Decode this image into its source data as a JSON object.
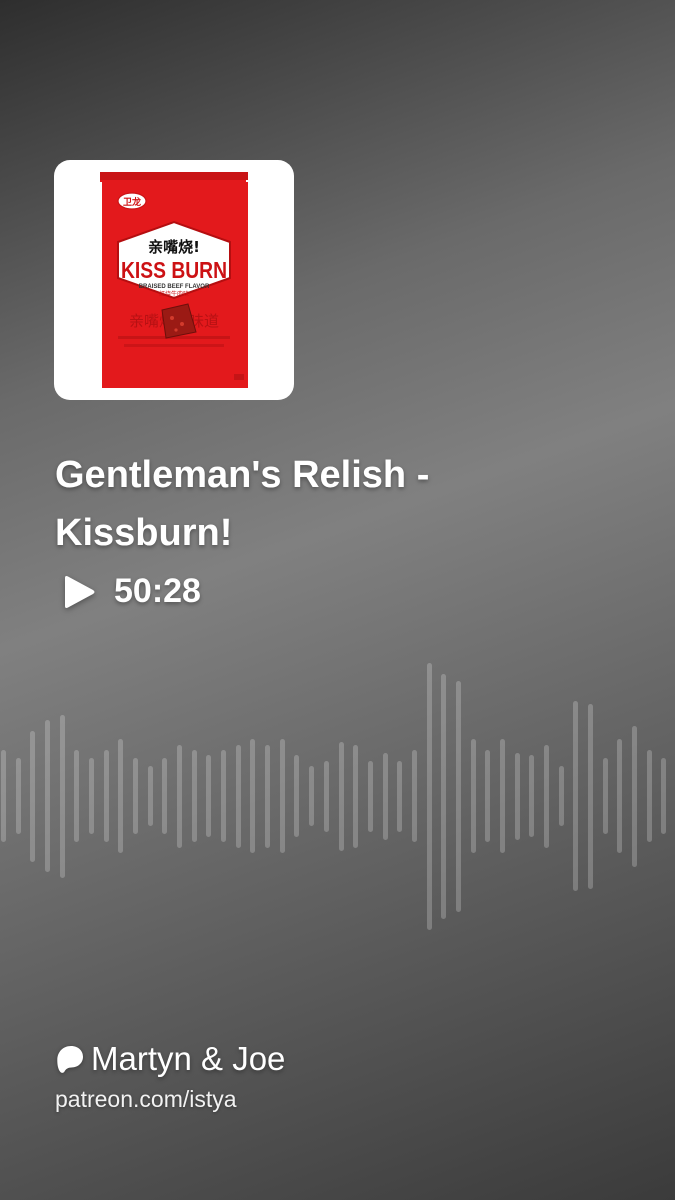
{
  "episode": {
    "title": "Gentleman's Relish - Kissburn!",
    "duration": "50:28",
    "artwork": {
      "subject": "Kiss Burn braised beef flavor snack bag",
      "brand_text": "卫龙",
      "headline_cn": "亲嘴烧!",
      "headline_en": "KISS BURN",
      "flavor_en": "BRAISED BEEF FLAVOR",
      "flavor_cn": "红烧牛肉味",
      "tagline_cn": "亲嘴烧的味道",
      "bag_color": "#e3191c"
    }
  },
  "creator": {
    "name": "Martyn & Joe",
    "url": "patreon.com/istya",
    "icon": "patreon-icon"
  },
  "waveform": {
    "bar_levels": [
      0.34,
      0.28,
      0.48,
      0.56,
      0.6,
      0.34,
      0.28,
      0.34,
      0.42,
      0.28,
      0.22,
      0.28,
      0.38,
      0.34,
      0.3,
      0.34,
      0.38,
      0.42,
      0.38,
      0.42,
      0.3,
      0.22,
      0.26,
      0.4,
      0.38,
      0.26,
      0.32,
      0.26,
      0.34,
      0.98,
      0.9,
      0.85,
      0.42,
      0.34,
      0.42,
      0.32,
      0.3,
      0.38,
      0.22,
      0.7,
      0.68,
      0.28,
      0.42,
      0.52,
      0.34,
      0.28
    ]
  },
  "colors": {
    "background_mid": "#808080",
    "background_dark": "#2e2e2e",
    "text": "#ffffff"
  }
}
